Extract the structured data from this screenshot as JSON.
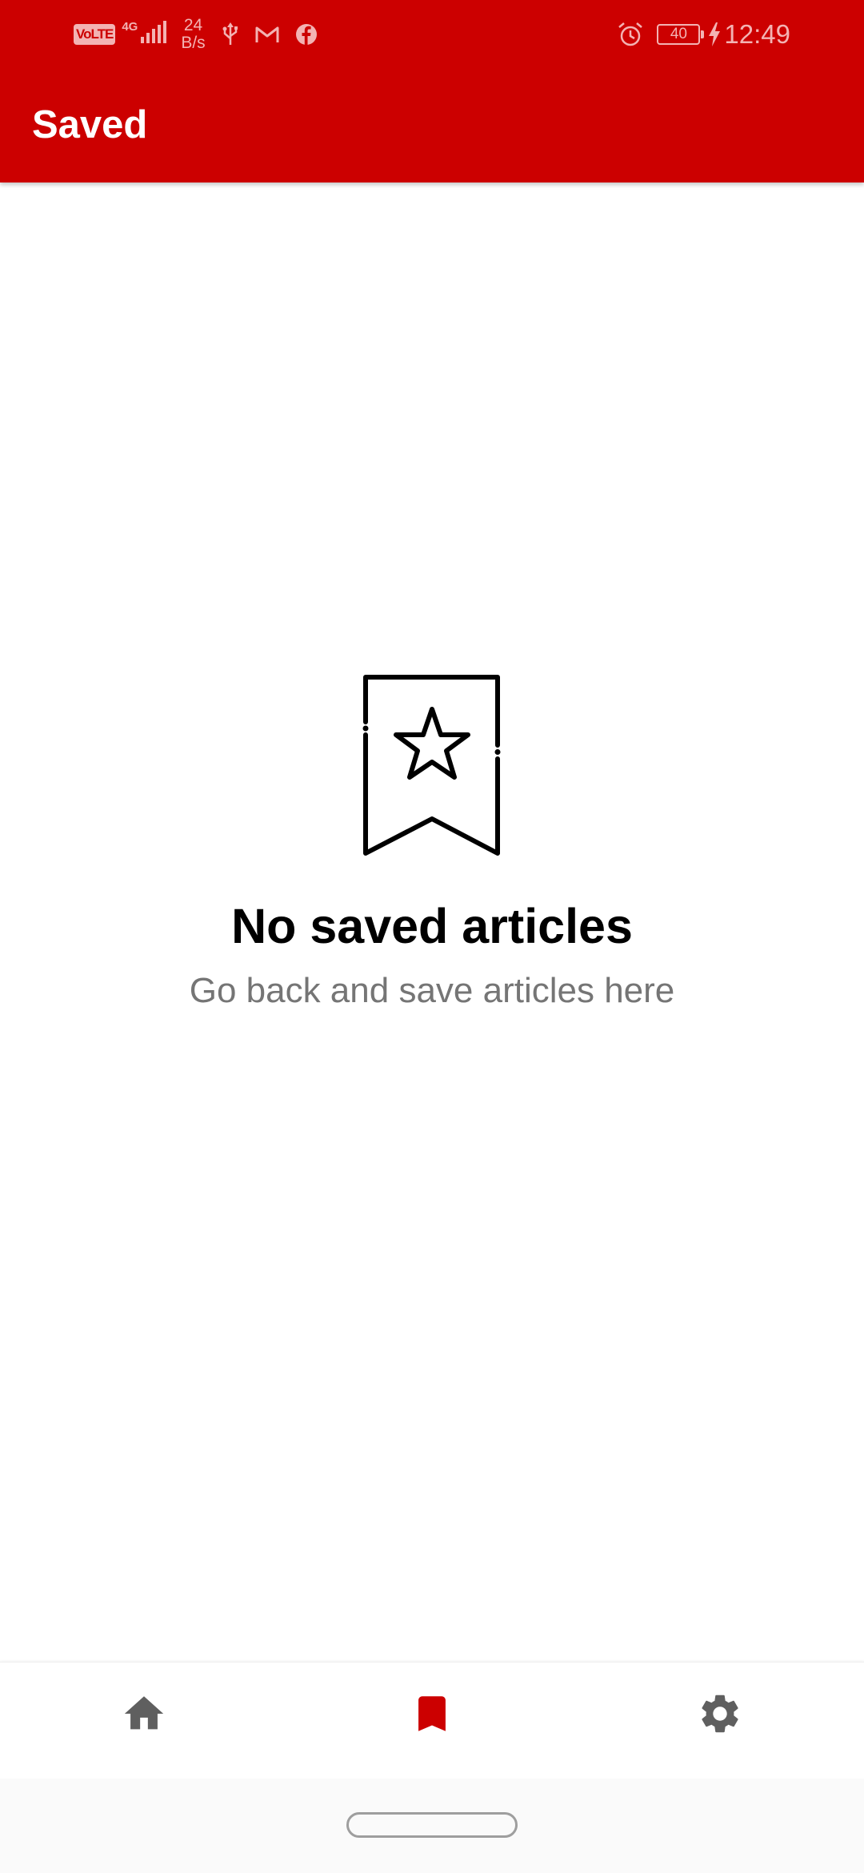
{
  "status_bar": {
    "network_badge": "VoLTE",
    "network_type": "4G",
    "speed_value": "24",
    "speed_unit": "B/s",
    "battery": "40",
    "time": "12:49",
    "icons": [
      "volte-icon",
      "signal-icon",
      "usb-icon",
      "gmail-icon",
      "facebook-icon",
      "alarm-icon",
      "battery-icon",
      "charging-icon"
    ]
  },
  "app_bar": {
    "title": "Saved"
  },
  "empty_state": {
    "icon": "bookmark-star-icon",
    "title": "No saved articles",
    "subtitle": "Go back and save articles here"
  },
  "bottom_nav": {
    "items": [
      {
        "icon": "home-icon",
        "active": false
      },
      {
        "icon": "bookmark-icon",
        "active": true
      },
      {
        "icon": "settings-icon",
        "active": false
      }
    ]
  },
  "colors": {
    "primary": "#cc0000",
    "status_text": "#f3b3b3",
    "nav_inactive": "#5f5f5f",
    "subtitle": "#757575"
  }
}
